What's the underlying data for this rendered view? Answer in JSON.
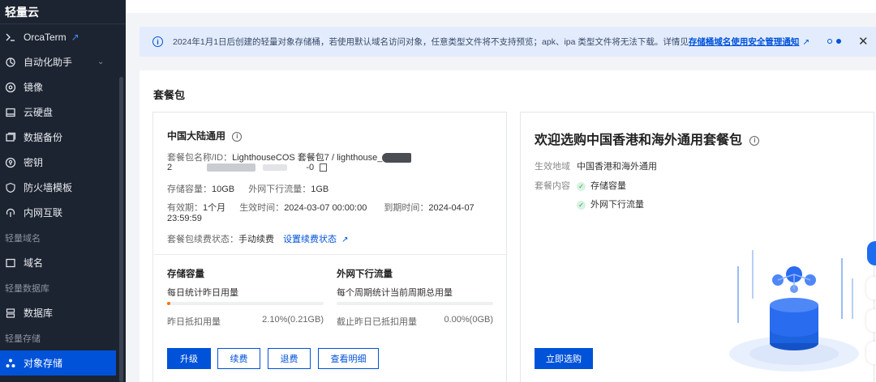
{
  "sidebar": {
    "brand": "轻量云",
    "items": [
      {
        "label": "OrcaTerm",
        "icon": "terminal-icon",
        "ext": "↗"
      },
      {
        "label": "自动化助手",
        "icon": "automation-icon",
        "chev": "⌄"
      },
      {
        "label": "镜像",
        "icon": "image-disc-icon"
      },
      {
        "label": "云硬盘",
        "icon": "disk-icon"
      },
      {
        "label": "数据备份",
        "icon": "backup-icon"
      },
      {
        "label": "密钥",
        "icon": "key-icon"
      },
      {
        "label": "防火墙模板",
        "icon": "shield-icon"
      },
      {
        "label": "内网互联",
        "icon": "network-icon"
      }
    ],
    "group_domain": "轻量域名",
    "domain_item": "域名",
    "group_db": "轻量数据库",
    "db_item": "数据库",
    "group_storage": "轻量存储",
    "storage_item": "对象存储"
  },
  "notice": {
    "text": "2024年1月1日后创建的轻量对象存储桶，若使用默认域名访问对象，任意类型文件将不支持预览；apk、ipa 类型文件将无法下载。详情见",
    "link": "存储桶域名使用安全管理通知",
    "close": "✕"
  },
  "panel": {
    "title": "套餐包",
    "left": {
      "title": "中国大陆通用",
      "name_key": "套餐包名称/ID：",
      "name_value": "LighthouseCOS 套餐包7 / lighthouse_",
      "id_prefix": "2",
      "id_suffix": "-0",
      "capacity_key": "存储容量：",
      "capacity_value": "10GB",
      "traffic_key": "外网下行流量：",
      "traffic_value": "1GB",
      "validity_key": "有效期：",
      "validity_value": "1个月",
      "start_key": "生效时间：",
      "start_value": "2024-03-07 00:00:00",
      "end_key": "到期时间：",
      "end_value": "2024-04-07",
      "end_time": "23:59:59",
      "renew_key": "套餐包续费状态：",
      "renew_value": "手动续费",
      "renew_link": "设置续费状态",
      "storage_title": "存储容量",
      "storage_desc": "每日统计昨日用量",
      "storage_usage_fraction": 0.021,
      "storage_stat_label": "昨日抵扣用量",
      "storage_stat_value": "2.10%(0.21GB)",
      "traffic_title": "外网下行流量",
      "traffic_desc": "每个周期统计当前周期总用量",
      "traffic_usage_fraction": 0,
      "traffic_stat_label": "截止昨日已抵扣用量",
      "traffic_stat_value": "0.00%(0GB)",
      "btn_upgrade": "升级",
      "btn_renew": "续费",
      "btn_refund": "退费",
      "btn_detail": "查看明细"
    },
    "right": {
      "title": "欢迎选购中国香港和海外通用套餐包",
      "region_key": "生效地域",
      "region_value": "中国香港和海外通用",
      "content_key": "套餐内容",
      "content_items": [
        "存储容量",
        "外网下行流量"
      ],
      "btn_buy": "立即选购"
    }
  },
  "colors": {
    "sidebar_bg": "#1d2431",
    "accent": "#0052d9",
    "notice_bg": "#e3ecfd",
    "usage_fill": "#ff7200"
  }
}
